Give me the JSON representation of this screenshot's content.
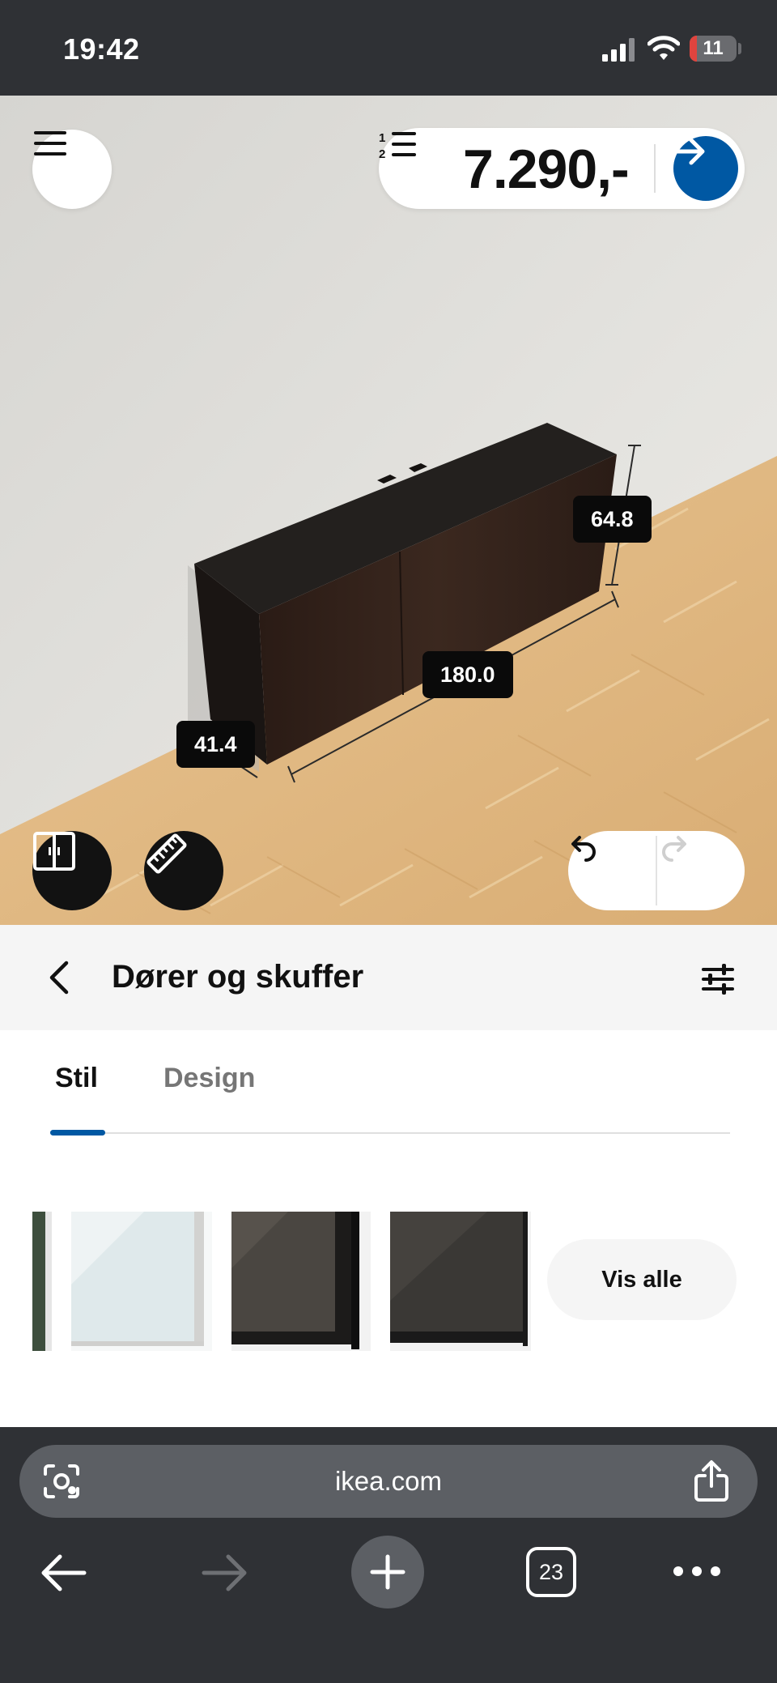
{
  "status_bar": {
    "time": "19:42",
    "battery": "11",
    "battery_level": 0.11
  },
  "toolbar": {
    "price": "7.290,-"
  },
  "dimensions": {
    "height": "64.8",
    "width": "180.0",
    "depth": "41.4"
  },
  "panel": {
    "title": "Dører og skuffer",
    "tabs": [
      {
        "label": "Stil",
        "active": true
      },
      {
        "label": "Design",
        "active": false
      }
    ],
    "options": [
      {
        "icon": "green-door-front-icon"
      },
      {
        "icon": "frosted-glass-door-icon"
      },
      {
        "icon": "smoked-glass-door-icon"
      },
      {
        "icon": "black-brown-door-icon"
      }
    ],
    "show_all": "Vis alle"
  },
  "browser": {
    "url": "ikea.com",
    "tab_count": "23"
  },
  "colors": {
    "accent": "#0058a3",
    "chrome": "#2f3135",
    "cabinet": "#241a16",
    "floor": "#e3bc86"
  }
}
